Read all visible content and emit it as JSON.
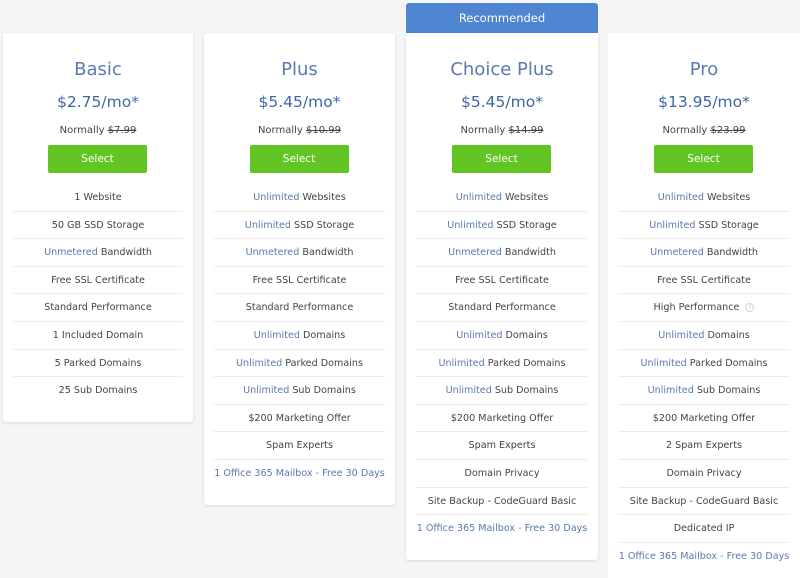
{
  "recommended_label": "Recommended",
  "colors": {
    "accent_blue": "#4e86d1",
    "select_green": "#63c523",
    "highlight_text": "#5a7ab0",
    "price_text": "#3f66a4"
  },
  "plans": [
    {
      "name": "Basic",
      "price": "$2.75/mo*",
      "normally_label": "Normally",
      "normal_price": "$7.99",
      "select_label": "Select",
      "features": [
        {
          "hl": "",
          "text": "1 Website"
        },
        {
          "hl": "",
          "text": "50 GB SSD Storage"
        },
        {
          "hl": "Unmetered",
          "text": " Bandwidth"
        },
        {
          "hl": "",
          "text": "Free SSL Certificate"
        },
        {
          "hl": "",
          "text": "Standard Performance"
        },
        {
          "hl": "",
          "text": "1 Included Domain"
        },
        {
          "hl": "",
          "text": "5 Parked Domains"
        },
        {
          "hl": "",
          "text": "25 Sub Domains"
        }
      ]
    },
    {
      "name": "Plus",
      "price": "$5.45/mo*",
      "normally_label": "Normally",
      "normal_price": "$10.99",
      "select_label": "Select",
      "features": [
        {
          "hl": "Unlimited",
          "text": " Websites"
        },
        {
          "hl": "Unlimited",
          "text": " SSD Storage"
        },
        {
          "hl": "Unmetered",
          "text": " Bandwidth"
        },
        {
          "hl": "",
          "text": "Free SSL Certificate"
        },
        {
          "hl": "",
          "text": "Standard Performance"
        },
        {
          "hl": "Unlimited",
          "text": " Domains"
        },
        {
          "hl": "Unlimited",
          "text": " Parked Domains"
        },
        {
          "hl": "Unlimited",
          "text": " Sub Domains"
        },
        {
          "hl": "",
          "text": "$200 Marketing Offer"
        },
        {
          "hl": "",
          "text": "Spam Experts"
        },
        {
          "hl": "",
          "text": "1 Office 365 Mailbox - Free 30 Days",
          "link": true
        }
      ]
    },
    {
      "name": "Choice Plus",
      "price": "$5.45/mo*",
      "normally_label": "Normally",
      "normal_price": "$14.99",
      "select_label": "Select",
      "features": [
        {
          "hl": "Unlimited",
          "text": " Websites"
        },
        {
          "hl": "Unlimited",
          "text": " SSD Storage"
        },
        {
          "hl": "Unmetered",
          "text": " Bandwidth"
        },
        {
          "hl": "",
          "text": "Free SSL Certificate"
        },
        {
          "hl": "",
          "text": "Standard Performance"
        },
        {
          "hl": "Unlimited",
          "text": " Domains"
        },
        {
          "hl": "Unlimited",
          "text": " Parked Domains"
        },
        {
          "hl": "Unlimited",
          "text": " Sub Domains"
        },
        {
          "hl": "",
          "text": "$200 Marketing Offer"
        },
        {
          "hl": "",
          "text": "Spam Experts"
        },
        {
          "hl": "",
          "text": "Domain Privacy"
        },
        {
          "hl": "",
          "text": "Site Backup - CodeGuard Basic"
        },
        {
          "hl": "",
          "text": "1 Office 365 Mailbox - Free 30 Days",
          "link": true
        }
      ]
    },
    {
      "name": "Pro",
      "price": "$13.95/mo*",
      "normally_label": "Normally",
      "normal_price": "$23.99",
      "select_label": "Select",
      "features": [
        {
          "hl": "Unlimited",
          "text": " Websites"
        },
        {
          "hl": "Unlimited",
          "text": " SSD Storage"
        },
        {
          "hl": "Unmetered",
          "text": " Bandwidth"
        },
        {
          "hl": "",
          "text": "Free SSL Certificate"
        },
        {
          "hl": "",
          "text": "High Performance",
          "info_icon": "?"
        },
        {
          "hl": "Unlimited",
          "text": " Domains"
        },
        {
          "hl": "Unlimited",
          "text": " Parked Domains"
        },
        {
          "hl": "Unlimited",
          "text": " Sub Domains"
        },
        {
          "hl": "",
          "text": "$200 Marketing Offer"
        },
        {
          "hl": "",
          "text": "2 Spam Experts"
        },
        {
          "hl": "",
          "text": "Domain Privacy"
        },
        {
          "hl": "",
          "text": "Site Backup - CodeGuard Basic"
        },
        {
          "hl": "",
          "text": "Dedicated IP"
        },
        {
          "hl": "",
          "text": "1 Office 365 Mailbox - Free 30 Days",
          "link": true
        }
      ]
    }
  ]
}
